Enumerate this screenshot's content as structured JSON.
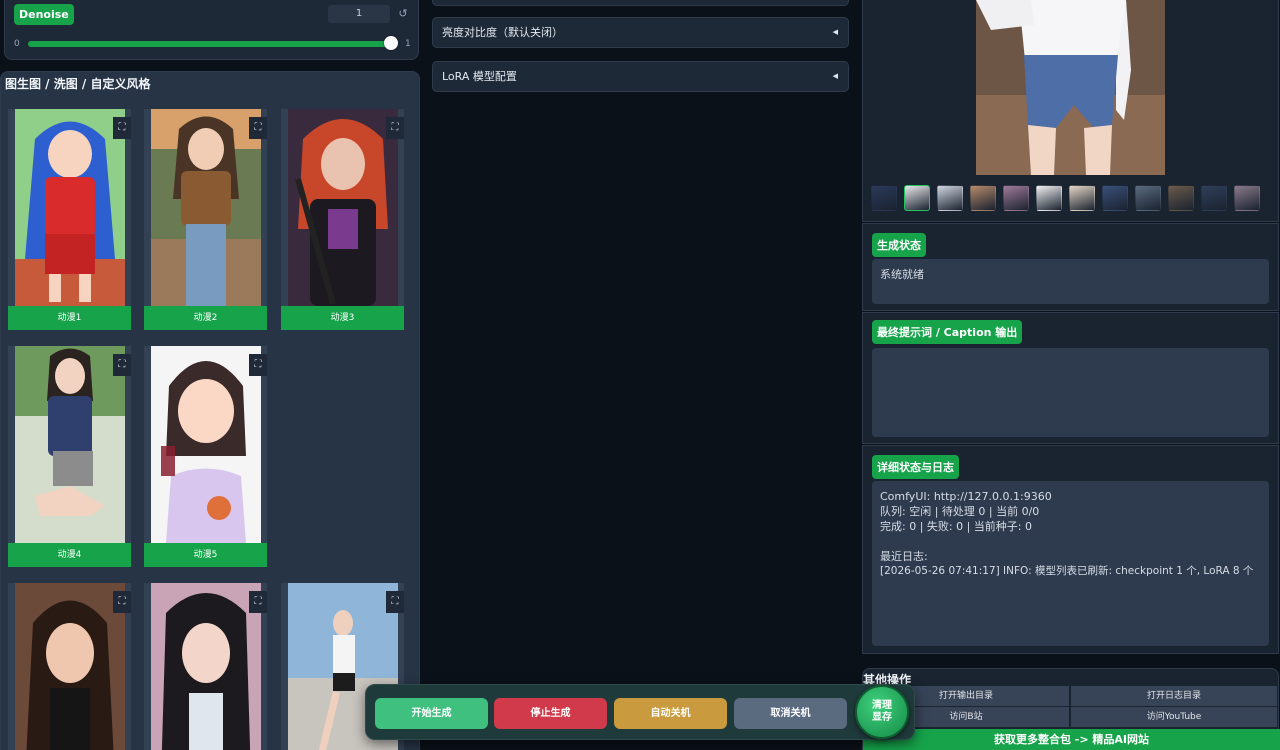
{
  "denoise": {
    "label": "Denoise",
    "value": "1",
    "min_label": "0",
    "max_label": "1",
    "slider_fraction": 1.0,
    "reset_icon": "reset-icon"
  },
  "style_gallery": {
    "title": "图生图 / 洗图 / 自定义风格",
    "items": [
      {
        "caption": "动漫1"
      },
      {
        "caption": "动漫2"
      },
      {
        "caption": "动漫3"
      },
      {
        "caption": "动漫4"
      },
      {
        "caption": "动漫5"
      },
      {
        "caption": ""
      },
      {
        "caption": ""
      },
      {
        "caption": ""
      }
    ],
    "expand_icon": "expand-icon"
  },
  "accordions": {
    "brightness": "亮度对比度（默认关闭）",
    "lora": "LoRA 模型配置"
  },
  "preview": {
    "thumbnail_count": 12,
    "selected_index": 1
  },
  "status": {
    "label": "生成状态",
    "text": "系统就绪"
  },
  "caption_output": {
    "label": "最终提示词 / Caption 输出",
    "text": ""
  },
  "logs": {
    "label": "详细状态与日志",
    "lines": [
      "ComfyUI: http://127.0.0.1:9360",
      "队列: 空闲 | 待处理 0 | 当前 0/0",
      "完成: 0 | 失败: 0 | 当前种子: 0",
      "",
      "最近日志:",
      "[2026-05-26 07:41:17] INFO: 模型列表已刷新: checkpoint 1 个, LoRA 8 个"
    ]
  },
  "other_ops": {
    "title": "其他操作",
    "open_output_dir": "打开输出目录",
    "open_log_dir": "打开日志目录",
    "visit_bilibili": "访问B站",
    "visit_youtube": "访问YouTube",
    "promo": "获取更多整合包 -> 精品AI网站"
  },
  "actions": {
    "start": "开始生成",
    "stop": "停止生成",
    "auto_shutdown": "自动关机",
    "cancel_shutdown": "取消关机",
    "clear_vram": "清理显存"
  },
  "colors": {
    "accent_green": "#16a34a",
    "start_green": "#3fc07f",
    "stop_red": "#d13a4a",
    "auto_gold": "#c99a3e",
    "cancel_slate": "#5a6b80"
  }
}
